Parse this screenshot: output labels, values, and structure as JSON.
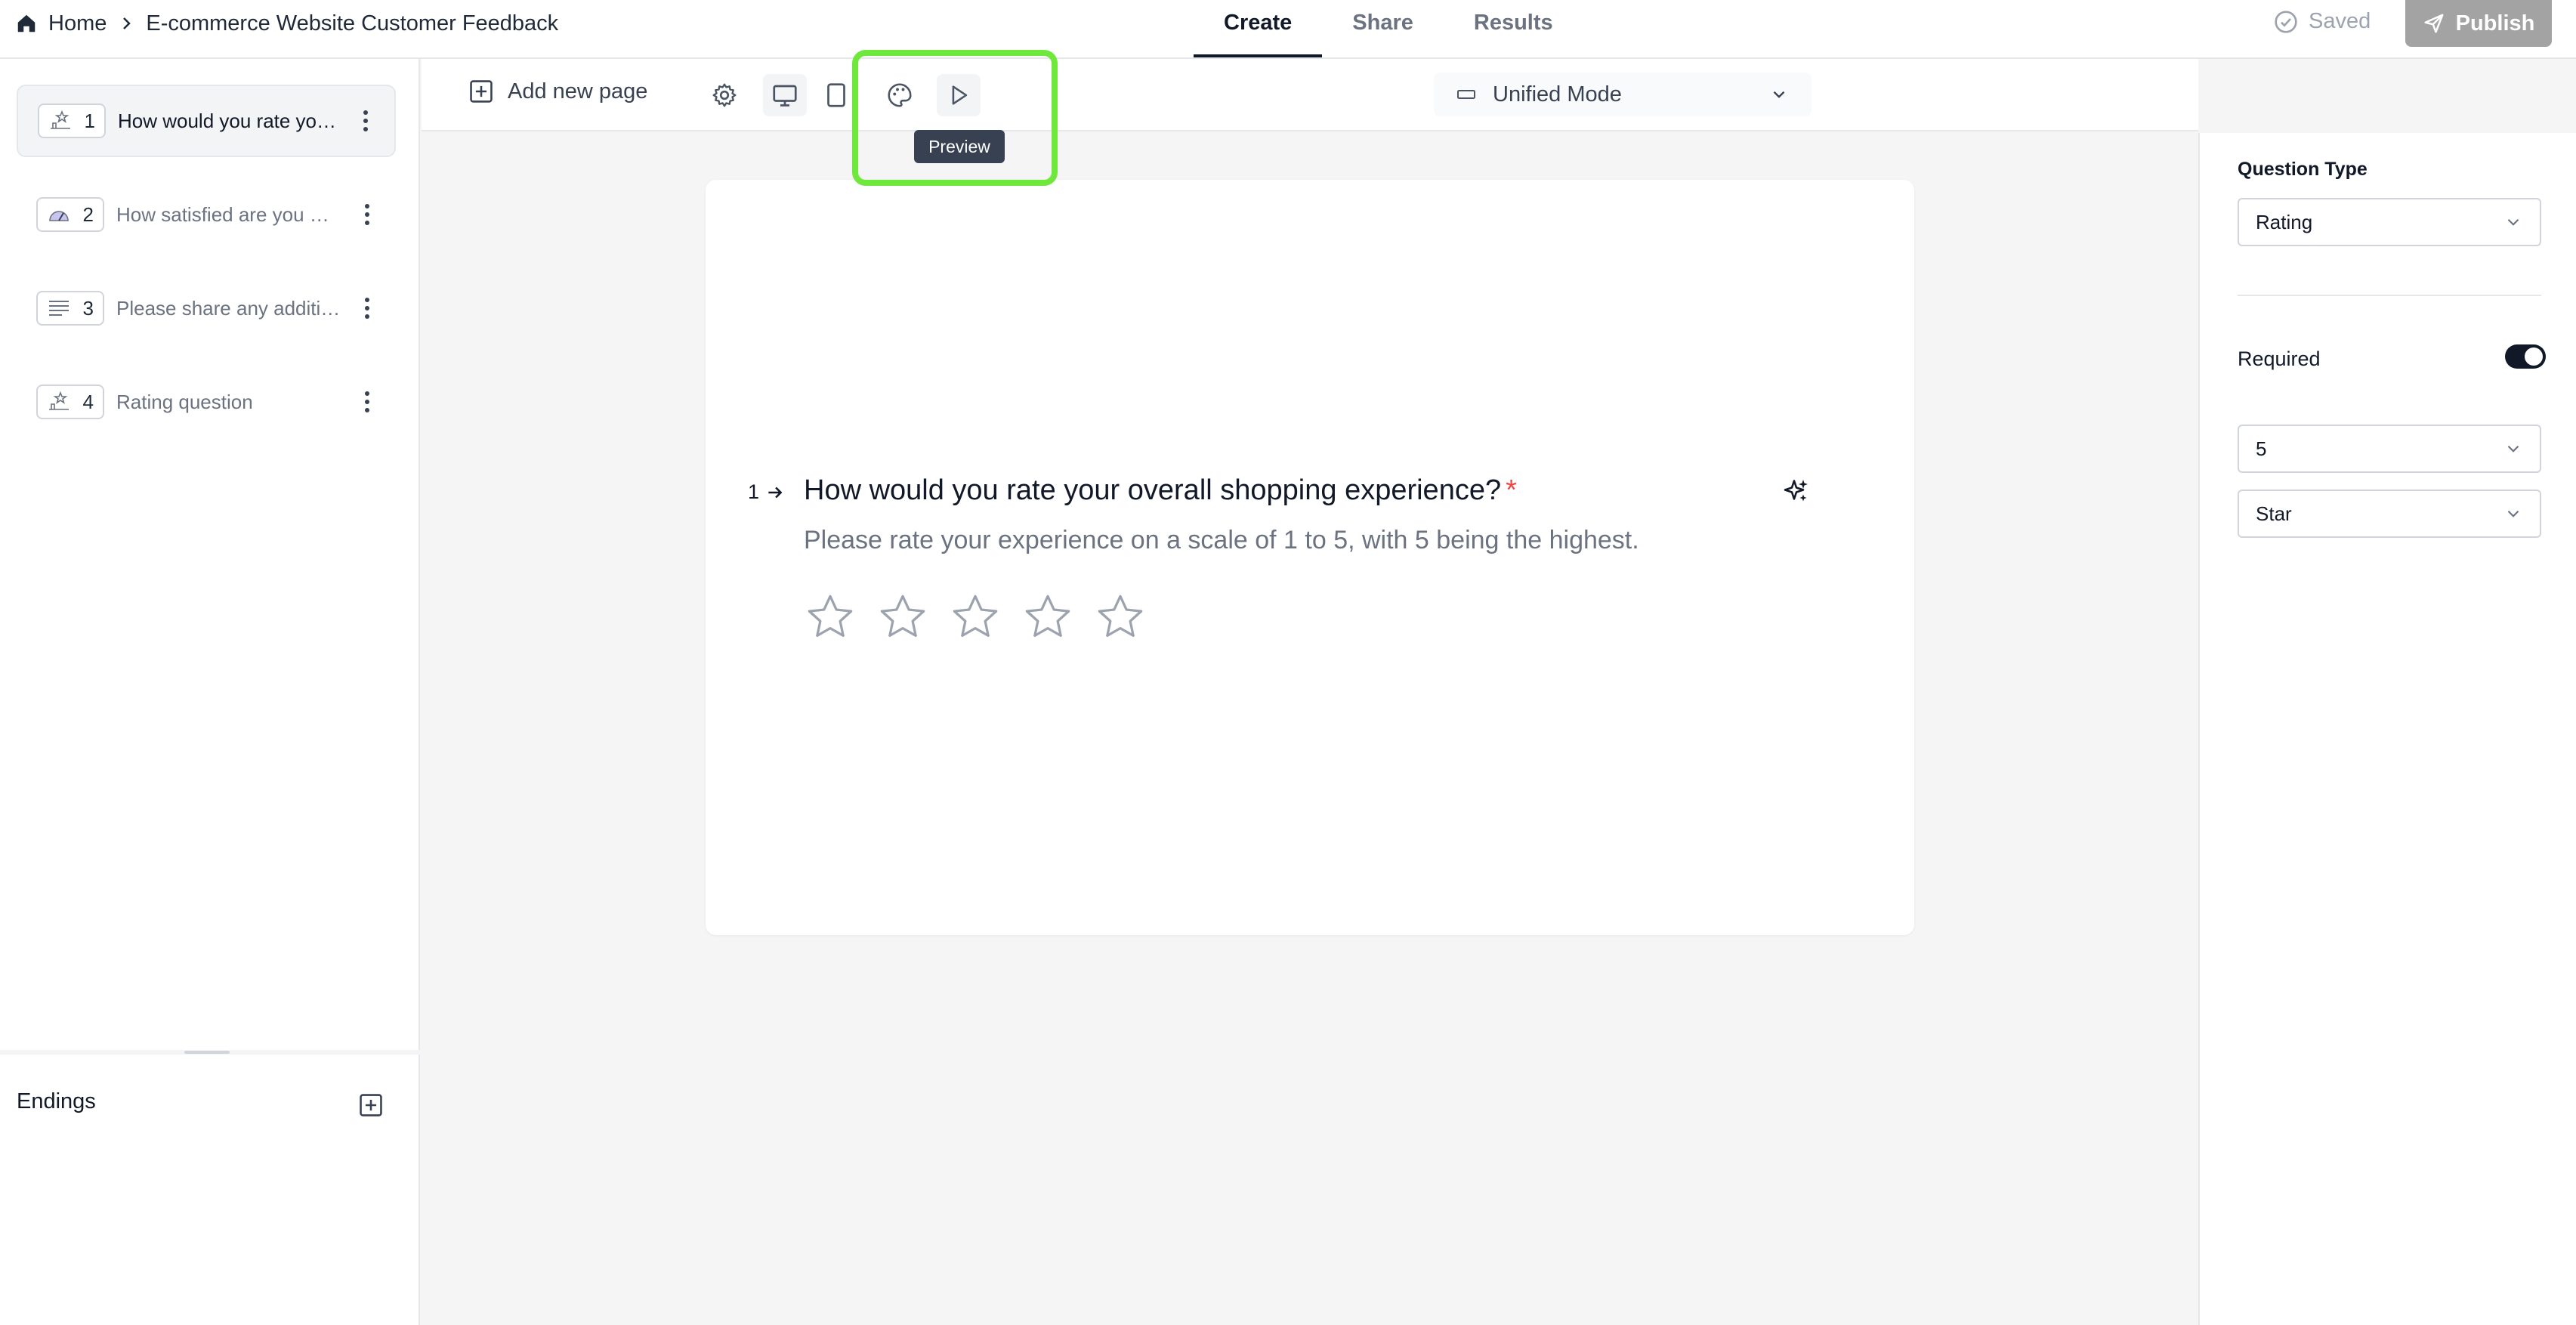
{
  "breadcrumb": {
    "home": "Home",
    "survey_title": "E-commerce Website Customer Feedback"
  },
  "tabs": [
    {
      "label": "Create",
      "active": true
    },
    {
      "label": "Share",
      "active": false
    },
    {
      "label": "Results",
      "active": false
    }
  ],
  "status": {
    "saved": "Saved"
  },
  "publish_label": "Publish",
  "questions": [
    {
      "num": "1",
      "label": "How would you rate your overall shopping experience?",
      "icon": "rating-icon",
      "active": true
    },
    {
      "num": "2",
      "label": "How satisfied are you with the website?",
      "icon": "gauge-icon",
      "active": false
    },
    {
      "num": "3",
      "label": "Please share any additional feedback",
      "icon": "text-lines-icon",
      "active": false
    },
    {
      "num": "4",
      "label": "Rating question",
      "icon": "rating-icon",
      "active": false
    }
  ],
  "endings_label": "Endings",
  "toolbar": {
    "add_page": "Add new page",
    "tooltip": "Preview",
    "mode": "Unified Mode"
  },
  "question": {
    "number": "1",
    "title": "How would you rate your overall shopping experience?",
    "required_mark": "*",
    "description": "Please rate your experience on a scale of 1 to 5, with 5 being the highest.",
    "star_count": 5
  },
  "settings": {
    "question_type_label": "Question Type",
    "question_type_value": "Rating",
    "required_label": "Required",
    "required": true,
    "scale_value": "5",
    "shape_value": "Star"
  },
  "colors": {
    "highlight": "#6ee83a",
    "required": "#ef4444",
    "publish_bg": "#a3a3a3"
  }
}
